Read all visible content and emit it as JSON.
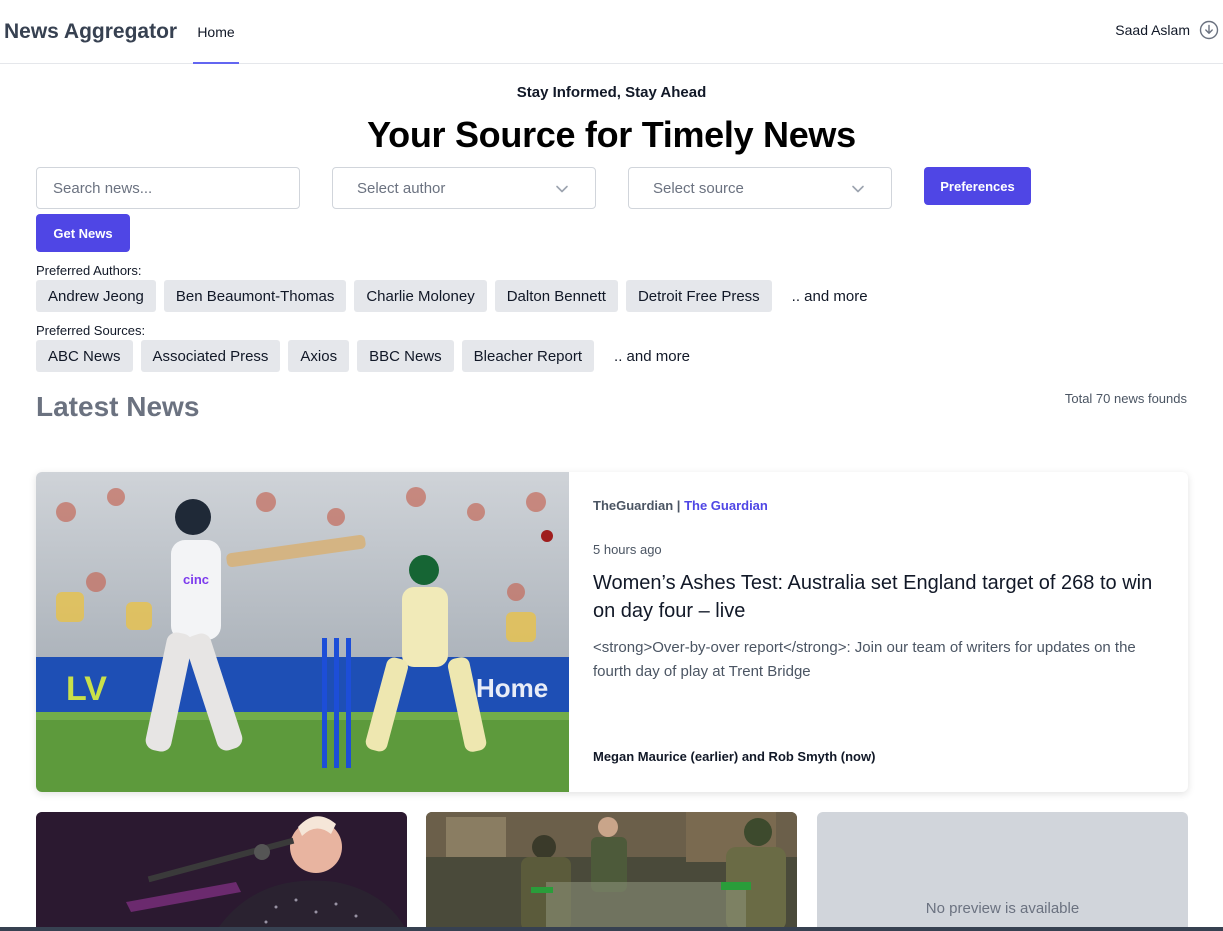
{
  "header": {
    "brand": "News Aggregator",
    "nav": {
      "home": "Home"
    },
    "user_name": "Saad Aslam",
    "user_icon": "download-circle-icon"
  },
  "hero": {
    "tagline": "Stay Informed, Stay Ahead",
    "headline": "Your Source for Timely News"
  },
  "filters": {
    "search_placeholder": "Search news...",
    "author_placeholder": "Select author",
    "source_placeholder": "Select source",
    "preferences_label": "Preferences",
    "get_news_label": "Get News"
  },
  "preferred_authors": {
    "label": "Preferred Authors:",
    "items": [
      "Andrew Jeong",
      "Ben Beaumont-Thomas",
      "Charlie Moloney",
      "Dalton Bennett",
      "Detroit Free Press"
    ],
    "more": ".. and more"
  },
  "preferred_sources": {
    "label": "Preferred Sources:",
    "items": [
      "ABC News",
      "Associated Press",
      "Axios",
      "BBC News",
      "Bleacher Report"
    ],
    "more": ".. and more"
  },
  "latest": {
    "title": "Latest News",
    "total": "Total 70 news founds"
  },
  "featured": {
    "source": "TheGuardian",
    "separator": " | ",
    "source_link": "The Guardian",
    "time": "5 hours ago",
    "title": "Women’s Ashes Test: Australia set England target of 268 to win on day four – live",
    "description": "<strong>Over-by-over report</strong>: Join our team of writers for updates on the fourth day of play at Trent Bridge",
    "author": "Megan Maurice (earlier) and Rob Smyth (now)"
  },
  "cards": {
    "no_preview": "No preview is available"
  },
  "colors": {
    "accent": "#4f46e5",
    "chip_bg": "#e5e7eb",
    "muted_text": "#6b7280"
  }
}
